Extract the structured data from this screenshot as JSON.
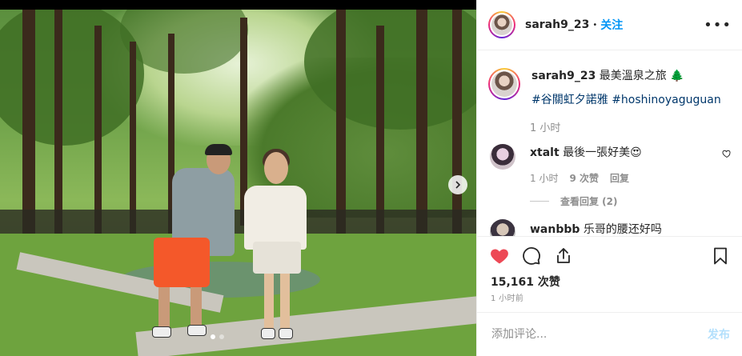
{
  "post": {
    "username": "sarah9_23",
    "separator": "•",
    "follow_label": "关注",
    "more_label": "•••",
    "caption_text": "最美溫泉之旅",
    "caption_emoji": "🌲",
    "hashtags": [
      "#谷關虹夕諾雅",
      "#hoshinoyaguguan"
    ],
    "caption_time": "1 小时",
    "carousel_dots": 2,
    "carousel_active": 0
  },
  "comments": [
    {
      "username": "xtalt",
      "text": "最後一張好美😍",
      "time": "1 小时",
      "likes": "9 次赞",
      "reply_label": "回复",
      "view_replies": "查看回复 (2)"
    },
    {
      "username": "wanbbb",
      "text": "乐哥的腰还好吗"
    }
  ],
  "stats": {
    "likes": "15,161 次赞",
    "time": "1 小时前"
  },
  "composer": {
    "placeholder": "添加评论...",
    "post_label": "发布"
  },
  "colors": {
    "like_red": "#ed4956",
    "link_blue": "#0095f6",
    "hashtag_blue": "#00376b",
    "muted": "#8e8e8e"
  }
}
